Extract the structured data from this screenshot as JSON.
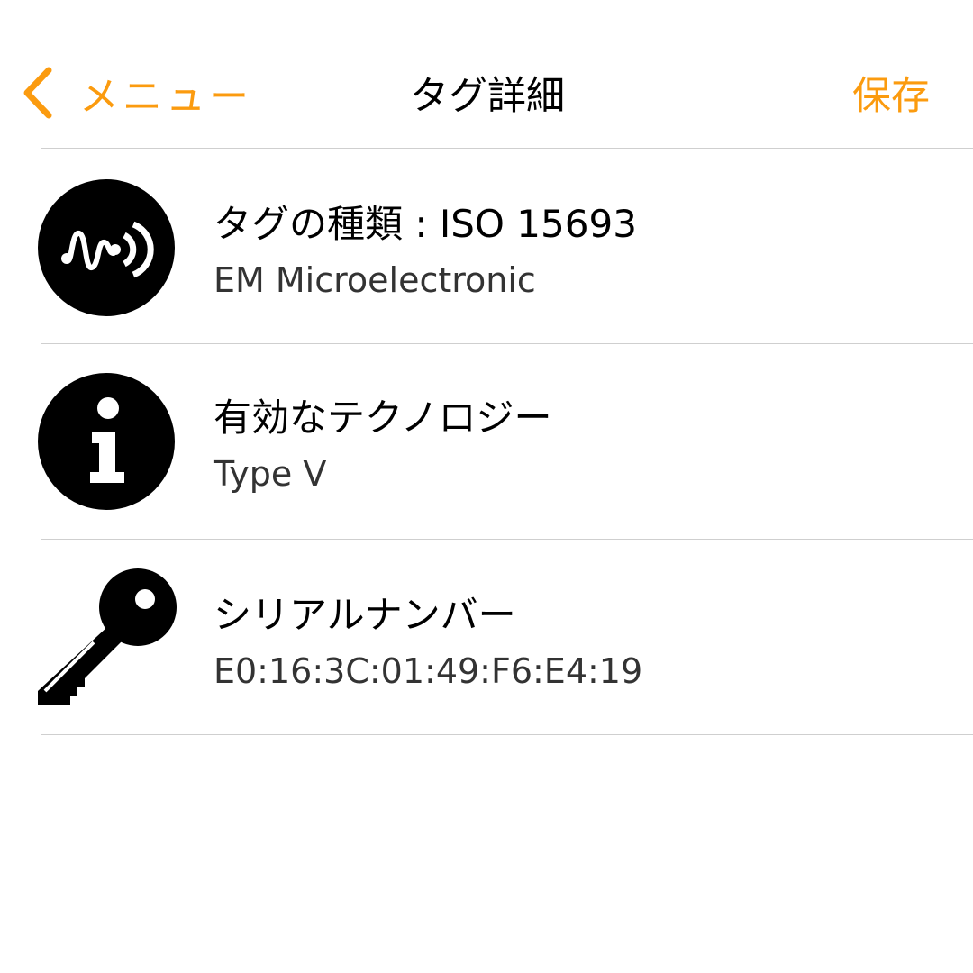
{
  "colors": {
    "accent": "#FB9B0F",
    "text": "#000000",
    "divider": "#CFCFCF"
  },
  "navbar": {
    "back_icon": "chevron-left-icon",
    "back_label": "メニュー",
    "title": "タグ詳細",
    "save_label": "保存"
  },
  "rows": [
    {
      "icon": "nfc-waveform-icon",
      "title": "タグの種類 : ISO 15693",
      "subtitle": "EM Microelectronic"
    },
    {
      "icon": "info-icon",
      "title": "有効なテクノロジー",
      "subtitle": "Type V"
    },
    {
      "icon": "key-icon",
      "title": "シリアルナンバー",
      "subtitle": "E0:16:3C:01:49:F6:E4:19"
    }
  ]
}
